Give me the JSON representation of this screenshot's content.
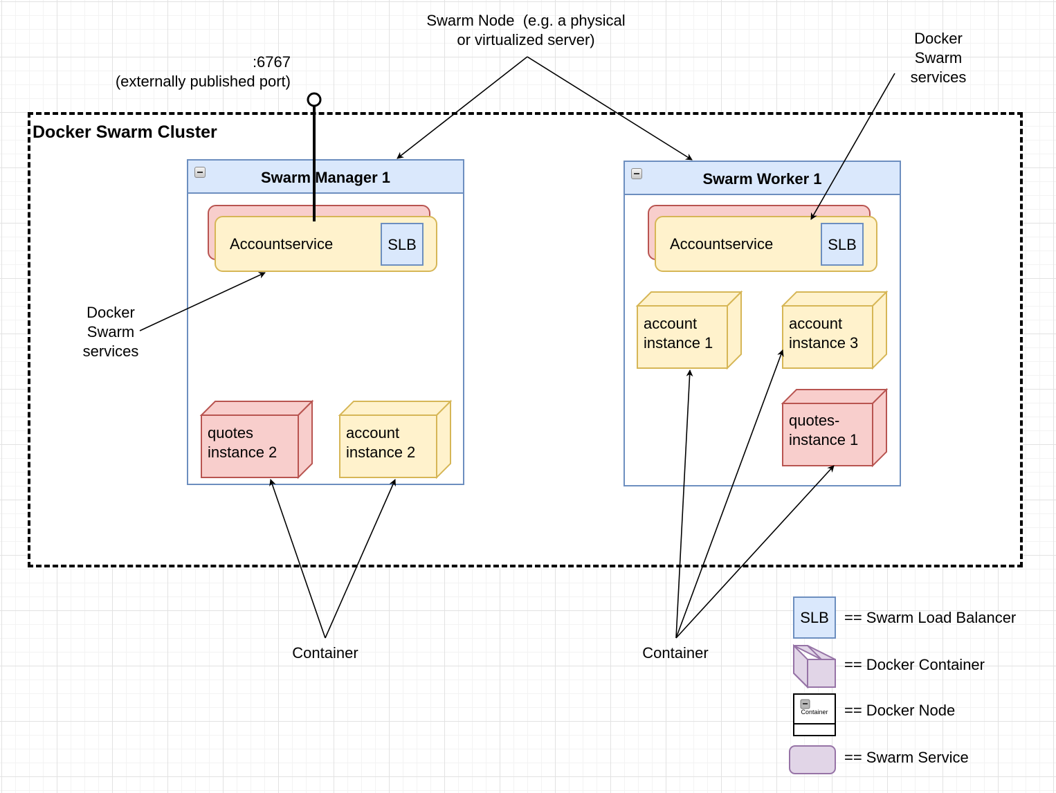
{
  "annotations": {
    "swarm_node": "Swarm Node  (e.g. a physical\nor virtualized server)",
    "port": ":6767\n(externally published port)",
    "docker_swarm_services_right": "Docker\nSwarm\nservices",
    "docker_swarm_services_left": "Docker\nSwarm\nservices",
    "container_left": "Container",
    "container_right": "Container"
  },
  "cluster": {
    "title": "Docker Swarm Cluster"
  },
  "nodes": [
    {
      "title": "Swarm Manager 1",
      "service": {
        "label": "Accountservice",
        "slb": "SLB"
      },
      "containers": [
        {
          "label": "quotes\ninstance 2",
          "kind": "quotes"
        },
        {
          "label": "account\ninstance 2",
          "kind": "account"
        }
      ]
    },
    {
      "title": "Swarm Worker 1",
      "service": {
        "label": "Accountservice",
        "slb": "SLB"
      },
      "containers": [
        {
          "label": "account\ninstance 1",
          "kind": "account"
        },
        {
          "label": "account\ninstance 3",
          "kind": "account"
        },
        {
          "label": "quotes-\ninstance 1",
          "kind": "quotes"
        }
      ]
    }
  ],
  "legend": [
    {
      "symbol": "SLB",
      "text": "== Swarm Load Balancer"
    },
    {
      "symbol": "",
      "text": "== Docker Container"
    },
    {
      "symbol": "Container",
      "text": "== Docker Node"
    },
    {
      "symbol": "",
      "text": "== Swarm Service"
    }
  ],
  "colors": {
    "slb_fill": "#dae8fc",
    "slb_stroke": "#6c8ebf",
    "account_fill": "#fff2cc",
    "account_stroke": "#d6b656",
    "quotes_fill": "#f8cecc",
    "quotes_stroke": "#b85450",
    "legend_purple_fill": "#e1d5e7",
    "legend_purple_stroke": "#9673a6"
  }
}
